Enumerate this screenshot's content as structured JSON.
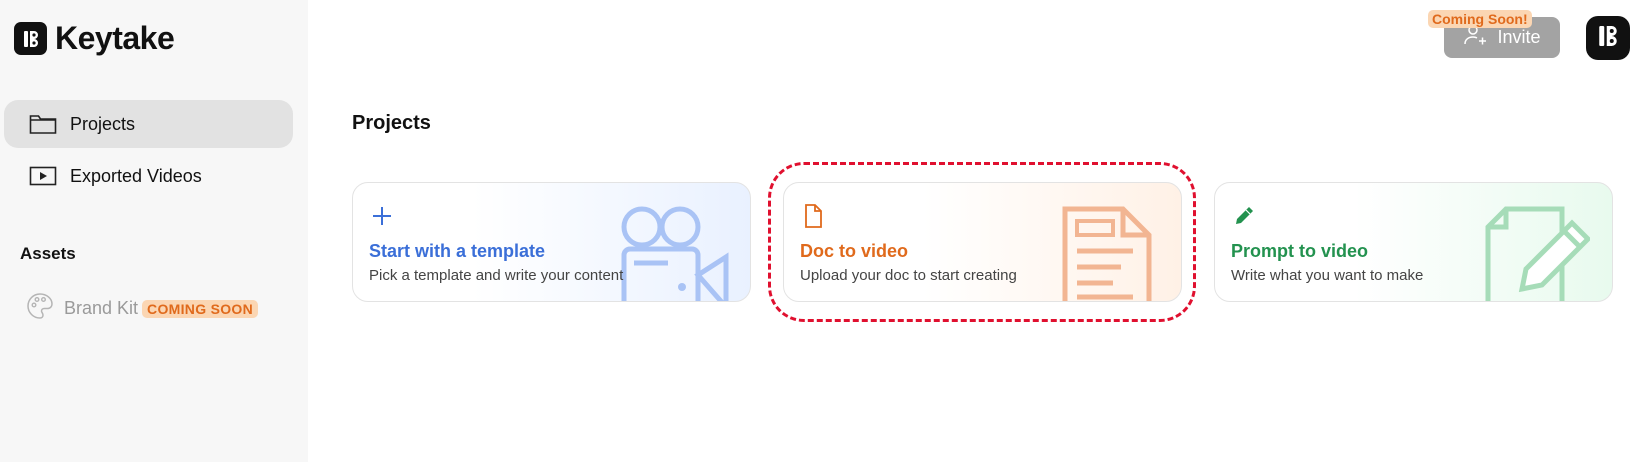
{
  "app": {
    "name": "Keytake"
  },
  "sidebar": {
    "items": [
      {
        "label": "Projects",
        "icon": "folder-icon",
        "active": true
      },
      {
        "label": "Exported Videos",
        "icon": "video-player-icon",
        "active": false
      }
    ],
    "assets_section": {
      "label": "Assets",
      "brand_kit": {
        "label": "Brand Kit",
        "badge": "COMING SOON",
        "icon": "palette-icon"
      }
    }
  },
  "header": {
    "coming_soon_tag": "Coming Soon!",
    "invite_label": "Invite",
    "invite_icon": "add-user-icon",
    "avatar_icon": "keytake-logo-icon"
  },
  "main": {
    "title": "Projects",
    "cards": [
      {
        "title": "Start with a template",
        "desc": "Pick a template and write your content",
        "icon": "plus-icon",
        "art": "video-camera-icon",
        "accent": "#3b6fd8"
      },
      {
        "title": "Doc to video",
        "desc": "Upload your doc to start creating",
        "icon": "document-icon",
        "art": "document-lines-icon",
        "accent": "#e06a1c"
      },
      {
        "title": "Prompt to video",
        "desc": "Write what you want to make",
        "icon": "pencil-icon",
        "art": "document-pencil-icon",
        "accent": "#23924f"
      }
    ]
  },
  "colors": {
    "highlight": "#e0102f",
    "badge_bg": "#fbd6b3",
    "badge_text": "#e06a1c",
    "active_nav_bg": "#e2e2e2"
  }
}
